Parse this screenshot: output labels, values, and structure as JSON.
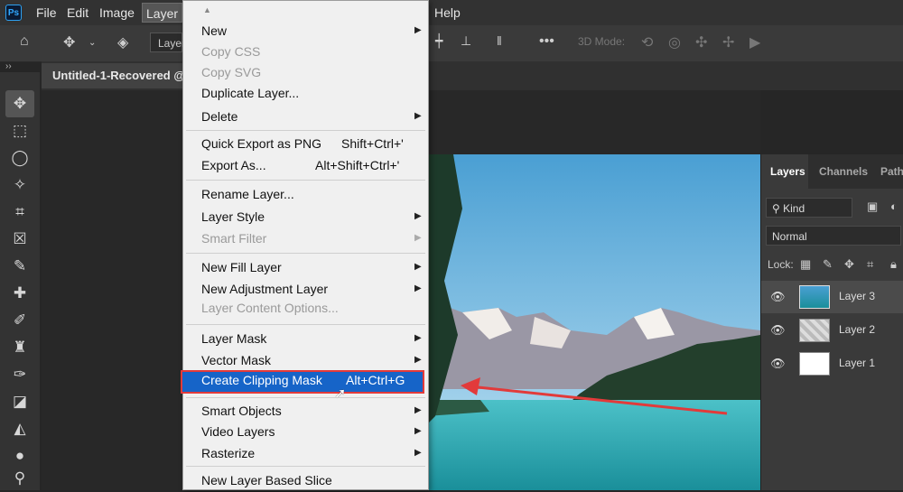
{
  "app": {
    "logo_text": "Ps"
  },
  "menubar": {
    "items": [
      "File",
      "Edit",
      "Image",
      "Layer"
    ],
    "right_item": "Help"
  },
  "options_bar": {
    "layer_dropdown": "Layer",
    "mode_3d_label": "3D Mode:"
  },
  "document_tab": {
    "title": "Untitled-1-Recovered @"
  },
  "layer_menu": {
    "scroll_up_glyph": "▲",
    "items": [
      {
        "label": "New",
        "submenu": true
      },
      {
        "label": "Copy CSS",
        "disabled": true
      },
      {
        "label": "Copy SVG",
        "disabled": true
      },
      {
        "label": "Duplicate Layer..."
      },
      {
        "label": "Delete",
        "submenu": true
      },
      {
        "label": "Quick Export as PNG",
        "shortcut": "Shift+Ctrl+'"
      },
      {
        "label": "Export As...",
        "shortcut": "Alt+Shift+Ctrl+'"
      },
      {
        "label": "Rename Layer..."
      },
      {
        "label": "Layer Style",
        "submenu": true
      },
      {
        "label": "Smart Filter",
        "submenu": true,
        "disabled": true
      },
      {
        "label": "New Fill Layer",
        "submenu": true
      },
      {
        "label": "New Adjustment Layer",
        "submenu": true
      },
      {
        "label": "Layer Content Options...",
        "disabled": true
      },
      {
        "label": "Layer Mask",
        "submenu": true
      },
      {
        "label": "Vector Mask",
        "submenu": true
      },
      {
        "label": "Create Clipping Mask",
        "shortcut": "Alt+Ctrl+G",
        "highlighted": true
      },
      {
        "label": "Smart Objects",
        "submenu": true
      },
      {
        "label": "Video Layers",
        "submenu": true
      },
      {
        "label": "Rasterize",
        "submenu": true
      },
      {
        "label": "New Layer Based Slice"
      }
    ]
  },
  "layers_panel": {
    "tabs": [
      "Layers",
      "Channels",
      "Path"
    ],
    "kind_filter": "Kind",
    "blend_mode": "Normal",
    "lock_label": "Lock:",
    "layers": [
      {
        "name": "Layer 3",
        "selected": true
      },
      {
        "name": "Layer 2"
      },
      {
        "name": "Layer 1"
      }
    ]
  },
  "colors": {
    "highlight": "#1664c8",
    "annotation": "#e23a3a"
  }
}
